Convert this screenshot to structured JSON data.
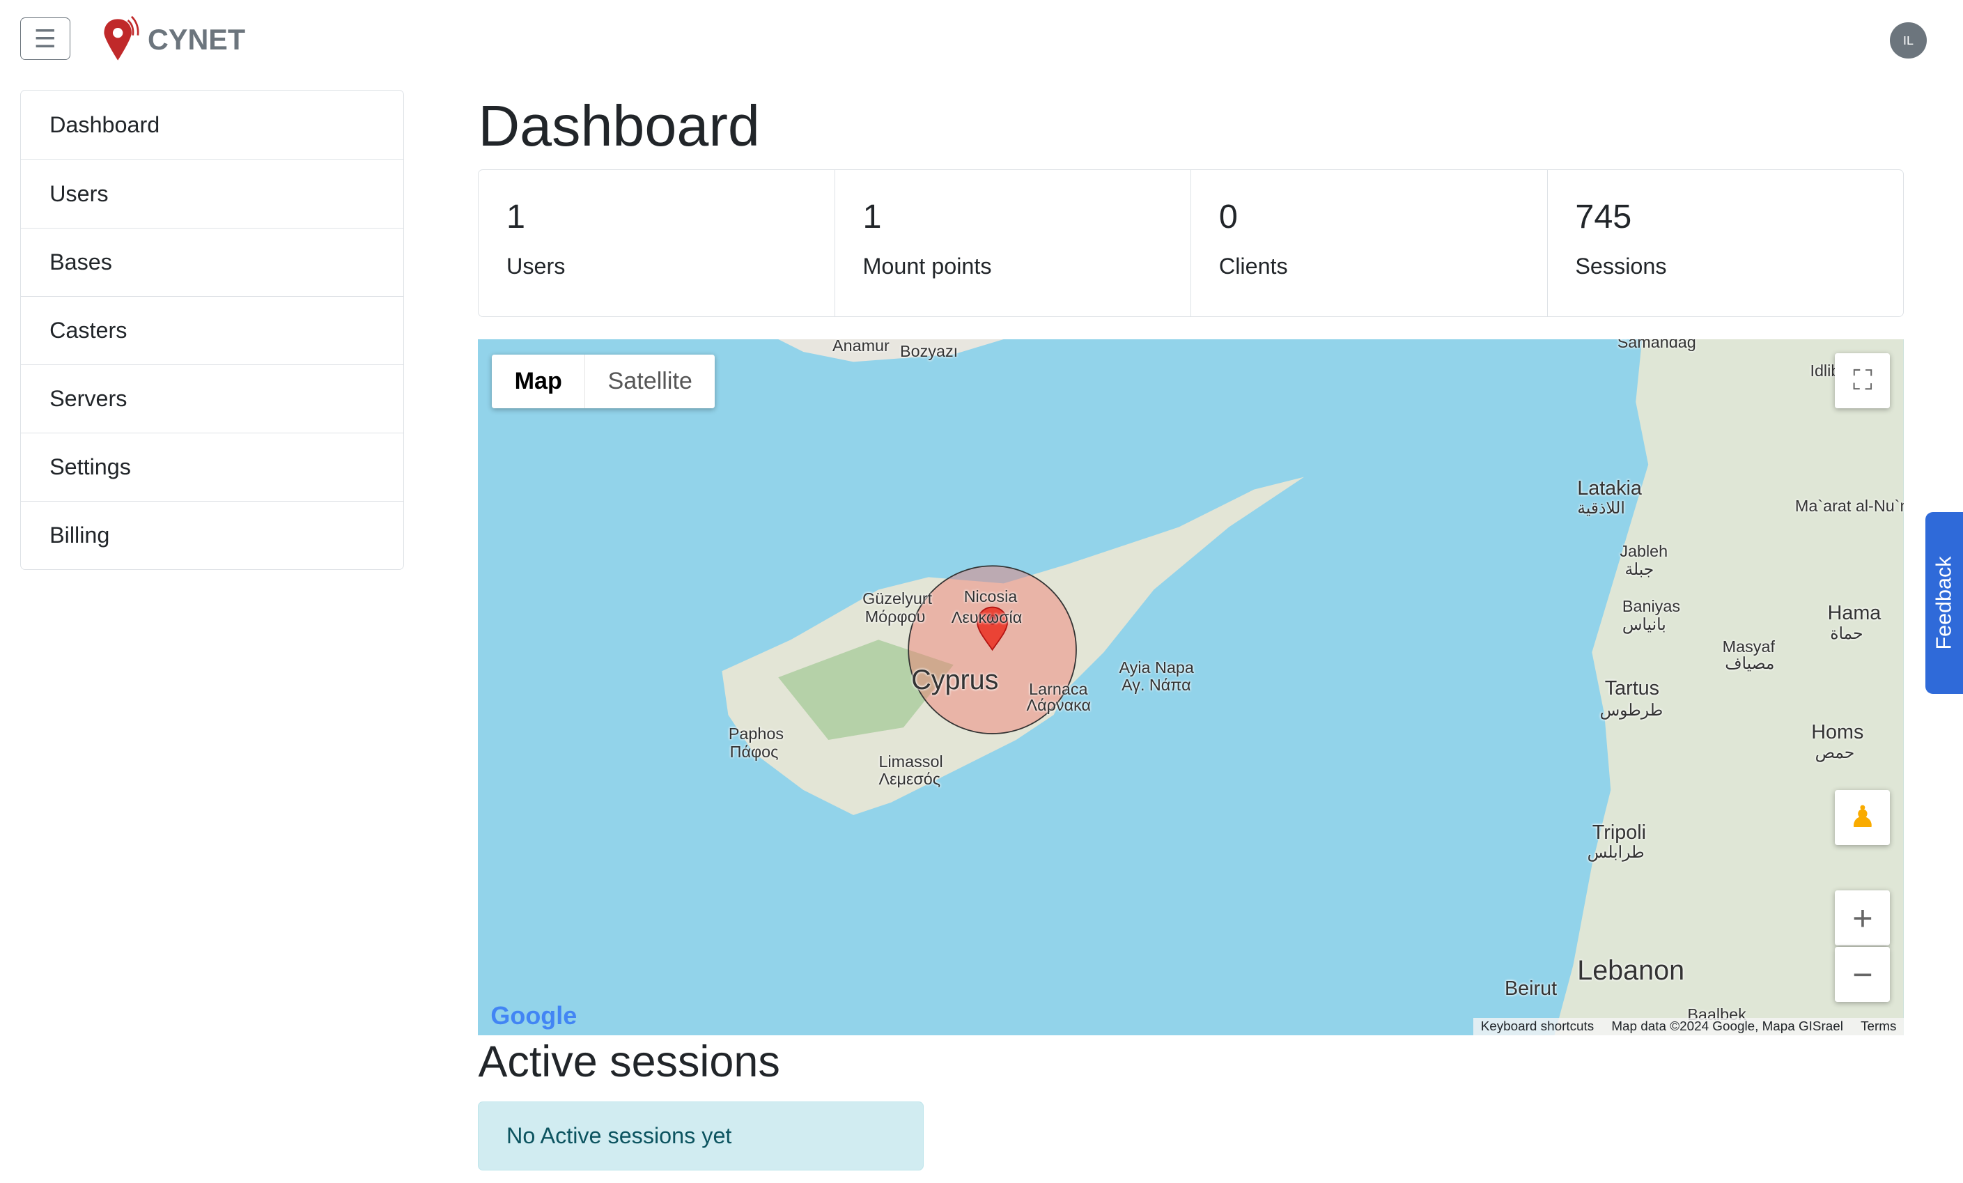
{
  "header": {
    "brand": "CYNET",
    "avatar_initials": "IL",
    "menu_icon": "hamburger-icon"
  },
  "sidebar": {
    "items": [
      {
        "label": "Dashboard"
      },
      {
        "label": "Users"
      },
      {
        "label": "Bases"
      },
      {
        "label": "Casters"
      },
      {
        "label": "Servers"
      },
      {
        "label": "Settings"
      },
      {
        "label": "Billing"
      }
    ]
  },
  "page": {
    "title": "Dashboard"
  },
  "stats": [
    {
      "value": "1",
      "label": "Users"
    },
    {
      "value": "1",
      "label": "Mount points"
    },
    {
      "value": "0",
      "label": "Clients"
    },
    {
      "value": "745",
      "label": "Sessions"
    }
  ],
  "map": {
    "type_map": "Map",
    "type_satellite": "Satellite",
    "google": "Google",
    "keyboard": "Keyboard shortcuts",
    "data": "Map data ©2024 Google, Mapa GISrael",
    "terms": "Terms",
    "labels": [
      "Anamur",
      "Bozyazı",
      "Samandağ",
      "Latakia",
      "اللاذقية",
      "Jableh",
      "جبلة",
      "Baniyas",
      "بانياس",
      "Tartus",
      "طرطوس",
      "Tripoli",
      "طرابلس",
      "Beirut",
      "Lebanon",
      "Homs",
      "حمص",
      "Hama",
      "حماة",
      "Masyaf",
      "مصياف",
      "Ma`arat al-Nu`man",
      "Idlib",
      "Güzelyurt",
      "Μόρφου",
      "Nicosia",
      "Λευκωσία",
      "Cyprus",
      "Larnaca",
      "Λάρνακα",
      "Ayia Napa",
      "Αγ. Νάπα",
      "Paphos",
      "Πάφος",
      "Limassol",
      "Λεμεσός",
      "Baalbek"
    ]
  },
  "sessions": {
    "title": "Active sessions",
    "empty": "No Active sessions yet"
  },
  "feedback": {
    "label": "Feedback"
  }
}
